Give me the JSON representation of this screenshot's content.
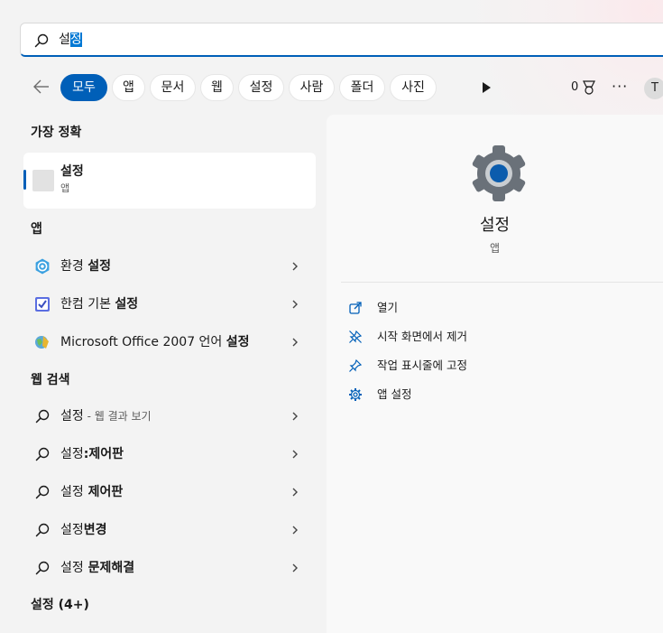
{
  "search": {
    "query_prefix": "설",
    "query_selected": "정"
  },
  "filters": {
    "tabs": [
      {
        "label": "모두"
      },
      {
        "label": "앱"
      },
      {
        "label": "문서"
      },
      {
        "label": "웹"
      },
      {
        "label": "설정"
      },
      {
        "label": "사람"
      },
      {
        "label": "폴더"
      },
      {
        "label": "사진"
      }
    ],
    "rewards_points": "0",
    "more_label": "···",
    "avatar_initial": "T"
  },
  "best_match": {
    "heading": "가장 정확",
    "title": "설정",
    "subtitle": "앱"
  },
  "apps": {
    "heading": "앱",
    "items": [
      {
        "prefix": "환경 ",
        "match": "설정",
        "suffix": ""
      },
      {
        "prefix": "한컴 기본 ",
        "match": "설정",
        "suffix": ""
      },
      {
        "prefix": "Microsoft Office 2007 언어 ",
        "match": "설정",
        "suffix": ""
      }
    ]
  },
  "web": {
    "heading": "웹 검색",
    "items": [
      {
        "base": "설정",
        "bold": "",
        "sub": " - 웹 결과 보기"
      },
      {
        "base": "설정",
        "bold": ":제어판",
        "sub": ""
      },
      {
        "base": "설정",
        "bold": " 제어판",
        "sub": ""
      },
      {
        "base": "설정",
        "bold": "변경",
        "sub": ""
      },
      {
        "base": "설정",
        "bold": " 문제해결",
        "sub": ""
      }
    ]
  },
  "settings_section": {
    "heading": "설정 (4+)"
  },
  "detail": {
    "title": "설정",
    "subtitle": "앱",
    "actions": [
      {
        "label": "열기",
        "icon": "open-icon"
      },
      {
        "label": "시작 화면에서 제거",
        "icon": "unpin-icon"
      },
      {
        "label": "작업 표시줄에 고정",
        "icon": "pin-icon"
      },
      {
        "label": "앱 설정",
        "icon": "gear-icon"
      }
    ]
  },
  "colors": {
    "accent": "#005fb8",
    "selection": "#0078d4"
  }
}
